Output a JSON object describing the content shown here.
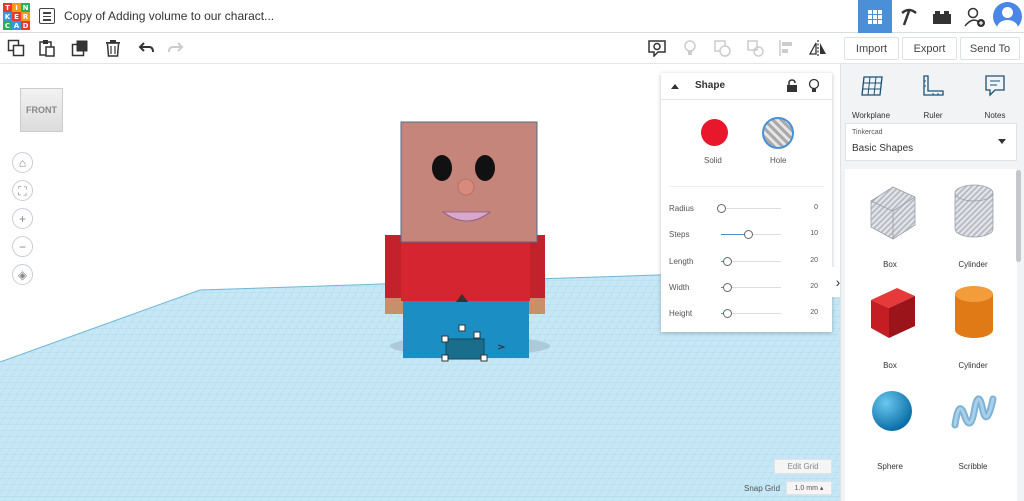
{
  "app": {
    "doc_title": "Copy of Adding volume to our charact...",
    "logo_letters": [
      "T",
      "I",
      "N",
      "K",
      "E",
      "R",
      "C",
      "A",
      "D"
    ],
    "logo_colors": [
      "#e8392a",
      "#f39c12",
      "#27ae60",
      "#3498db",
      "#e8392a",
      "#f39c12",
      "#27ae60",
      "#3498db",
      "#e8392a"
    ]
  },
  "header": {
    "buttons": [
      {
        "name": "3d-view-icon",
        "active": true
      },
      {
        "name": "pickaxe-icon",
        "active": false
      },
      {
        "name": "bricks-icon",
        "active": false
      },
      {
        "name": "add-user-icon",
        "active": false
      }
    ]
  },
  "actions": {
    "import": "Import",
    "export": "Export",
    "send_to": "Send To"
  },
  "viewcube": {
    "label": "FRONT"
  },
  "nav": {
    "home": "⌂",
    "fit": "⛶",
    "zoom_in": "+",
    "zoom_out": "−",
    "ortho": "◈"
  },
  "shape_panel": {
    "title": "Shape",
    "solid_label": "Solid",
    "hole_label": "Hole",
    "solid_color": "#e8172c",
    "params": [
      {
        "label": "Radius",
        "value": "0",
        "fraction": 0.0
      },
      {
        "label": "Steps",
        "value": "10",
        "fraction": 0.45
      },
      {
        "label": "Length",
        "value": "20",
        "fraction": 0.1
      },
      {
        "label": "Width",
        "value": "20",
        "fraction": 0.1
      },
      {
        "label": "Height",
        "value": "20",
        "fraction": 0.1
      }
    ]
  },
  "library": {
    "tools": [
      {
        "label": "Workplane",
        "icon": "workplane-icon"
      },
      {
        "label": "Ruler",
        "icon": "ruler-icon"
      },
      {
        "label": "Notes",
        "icon": "notes-icon"
      }
    ],
    "category_small": "Tinkercad",
    "category": "Basic Shapes",
    "shapes": [
      {
        "label": "Box",
        "icon": "box-hole-icon"
      },
      {
        "label": "Cylinder",
        "icon": "cylinder-hole-icon"
      },
      {
        "label": "Box",
        "icon": "box-solid-icon"
      },
      {
        "label": "Cylinder",
        "icon": "cylinder-solid-icon"
      },
      {
        "label": "Sphere",
        "icon": "sphere-icon"
      },
      {
        "label": "Scribble",
        "icon": "scribble-icon"
      }
    ]
  },
  "grid": {
    "edit_label": "Edit Grid",
    "snap_label": "Snap Grid",
    "snap_value": "1.0 mm ▴"
  },
  "colors": {
    "accent": "#4a90d9",
    "grid_floor": "#bfe3f2",
    "head": "#c5857a",
    "shirt": "#d42530",
    "pants": "#1b8fc4"
  }
}
